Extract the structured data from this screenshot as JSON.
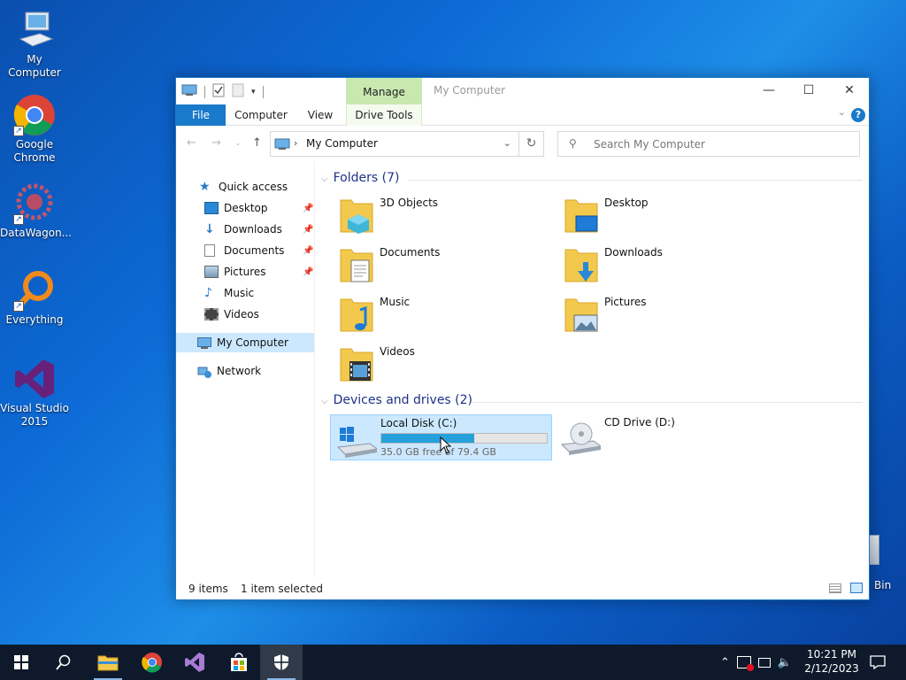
{
  "desktop": {
    "icons": [
      {
        "label": "My Computer",
        "icon": "computer-icon"
      },
      {
        "label": "Google\nChrome",
        "icon": "chrome-icon"
      },
      {
        "label": "DataWagon...",
        "icon": "datawagon-icon"
      },
      {
        "label": "Everything",
        "icon": "everything-icon"
      },
      {
        "label": "Visual Studio\n2015",
        "icon": "visual-studio-icon"
      }
    ],
    "partial_label": "Bin"
  },
  "window": {
    "title": "My Computer",
    "context_tab": "Manage",
    "ribbon_tabs": [
      "File",
      "Computer",
      "View",
      "Drive Tools"
    ],
    "address": {
      "path": "My Computer"
    },
    "search": {
      "placeholder": "Search My Computer"
    },
    "nav": {
      "quick_access": "Quick access",
      "items": [
        {
          "label": "Desktop",
          "pinned": true
        },
        {
          "label": "Downloads",
          "pinned": true
        },
        {
          "label": "Documents",
          "pinned": true
        },
        {
          "label": "Pictures",
          "pinned": true
        },
        {
          "label": "Music",
          "pinned": false
        },
        {
          "label": "Videos",
          "pinned": false
        }
      ],
      "this_pc": "My Computer",
      "network": "Network"
    },
    "folders_header": "Folders (7)",
    "folders": [
      {
        "label": "3D Objects",
        "icon": "3d-objects-folder-icon"
      },
      {
        "label": "Desktop",
        "icon": "desktop-folder-icon"
      },
      {
        "label": "Documents",
        "icon": "documents-folder-icon"
      },
      {
        "label": "Downloads",
        "icon": "downloads-folder-icon"
      },
      {
        "label": "Music",
        "icon": "music-folder-icon"
      },
      {
        "label": "Pictures",
        "icon": "pictures-folder-icon"
      },
      {
        "label": "Videos",
        "icon": "videos-folder-icon"
      }
    ],
    "devices_header": "Devices and drives (2)",
    "drives": [
      {
        "label": "Local Disk (C:)",
        "capacity": "35.0 GB free of 79.4 GB",
        "used_fraction": 0.56,
        "selected": true
      },
      {
        "label": "CD Drive (D:)",
        "selected": false
      }
    ],
    "status": {
      "items": "9 items",
      "selected": "1 item selected"
    }
  },
  "taskbar": {
    "clock_time": "10:21 PM",
    "clock_date": "2/12/2023",
    "accent": "#1979ca"
  }
}
